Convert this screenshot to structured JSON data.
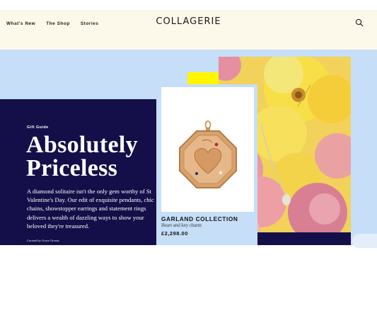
{
  "header": {
    "nav": [
      "What's New",
      "The Shop",
      "Stories"
    ],
    "logo": "COLLAGERIE",
    "search_icon": "search-icon"
  },
  "hero": {
    "eyebrow": "Gift Guide",
    "headline_line1": "Absolutely",
    "headline_line2": "Priceless",
    "body": "A diamond solitaire isn't the only gem worthy of St Valentine's Day. Our edit of exquisite pendants, chic chains, showstopper earrings and statement rings delivers a wealth of dazzling ways to show your beloved they're treasured.",
    "curated": "Curated by Grace Givens"
  },
  "product": {
    "title": "GARLAND COLLECTION",
    "subtitle": "Heart and key charm",
    "price": "£2,298.00"
  },
  "colors": {
    "header_bg": "#fdf9ea",
    "hero_bg": "#c6def8",
    "navy": "#140f48",
    "accent_yellow": "#fff600"
  }
}
